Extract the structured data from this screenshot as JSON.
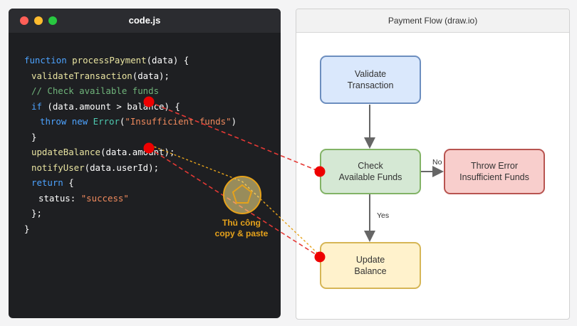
{
  "editor": {
    "filename": "code.js",
    "lines": [
      [
        {
          "t": "function",
          "c": "kw"
        },
        {
          "t": " processPayment",
          "c": "fn"
        },
        {
          "t": "(data) {",
          "c": ""
        }
      ],
      [
        {
          "t": "validateTransaction",
          "c": "fn"
        },
        {
          "t": "(data);",
          "c": ""
        }
      ],
      [
        {
          "t": "// Check available funds",
          "c": "cm"
        }
      ],
      [
        {
          "t": "if",
          "c": "kw"
        },
        {
          "t": " (data.amount > balance) {",
          "c": ""
        }
      ],
      [
        {
          "t": "throw",
          "c": "kw"
        },
        {
          "t": " new",
          "c": "kw"
        },
        {
          "t": " Error",
          "c": "cls"
        },
        {
          "t": "(",
          "c": ""
        },
        {
          "t": "\"Insufficient funds\"",
          "c": "str"
        },
        {
          "t": ")",
          "c": ""
        }
      ],
      [
        {
          "t": "}",
          "c": ""
        }
      ],
      [
        {
          "t": "updateBalance",
          "c": "fn"
        },
        {
          "t": "(data.amount);",
          "c": ""
        }
      ],
      [
        {
          "t": "notifyUser",
          "c": "fn"
        },
        {
          "t": "(data.userId);",
          "c": ""
        }
      ],
      [
        {
          "t": "return",
          "c": "kw"
        },
        {
          "t": " {",
          "c": ""
        }
      ],
      [
        {
          "t": "status: ",
          "c": ""
        },
        {
          "t": "\"success\"",
          "c": "str"
        }
      ],
      [
        {
          "t": "};",
          "c": ""
        }
      ],
      [
        {
          "t": "}",
          "c": ""
        }
      ]
    ]
  },
  "diagram": {
    "title": "Payment Flow (draw.io)",
    "nodes": {
      "validate": [
        "Validate",
        "Transaction"
      ],
      "check": [
        "Check",
        "Available Funds"
      ],
      "throw": [
        "Throw Error",
        "Insufficient Funds"
      ],
      "update": [
        "Update",
        "Balance"
      ]
    },
    "edge_labels": {
      "no": "No",
      "yes": "Yes"
    }
  },
  "annotation": {
    "line1": "Thủ công",
    "line2": "copy & paste"
  },
  "colors": {
    "link_red": "#e53935",
    "manual_orange": "#e6a21b"
  }
}
